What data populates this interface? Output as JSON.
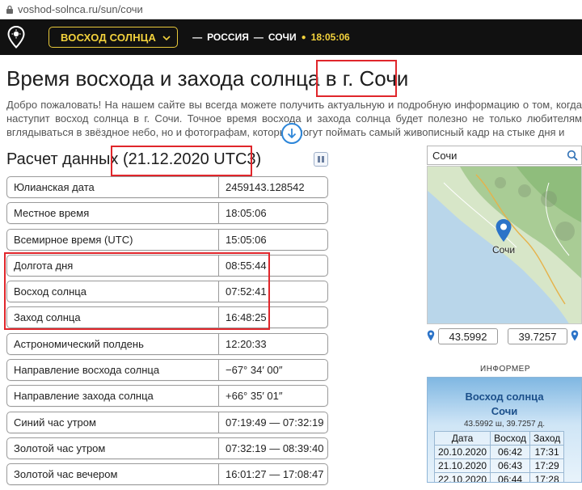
{
  "browser": {
    "url": "voshod-solnca.ru/sun/сочи"
  },
  "header": {
    "menu_label": "ВОСХОД СОЛНЦА",
    "crumb_country": "РОССИЯ",
    "crumb_city": "СОЧИ",
    "time": "18:05:06",
    "sep": "—",
    "dot": "●"
  },
  "page": {
    "title": "Время восхода и захода солнца в г. Сочи",
    "intro": "Добро пожаловать! На нашем сайте вы всегда можете получить актуальную и подробную информацию о том, когда наступит восход солнца в г. Сочи. Точное время восхода и захода солнца будет полезно не только любителям вглядываться в звёздное небо, но и фотографам, которые могут поймать самый живописный кадр на стыке дня и",
    "calc_title": "Расчет данных (21.12.2020 UTC3)"
  },
  "rows": [
    {
      "k": "Юлианская дата",
      "v": "2459143.128542"
    },
    {
      "k": "Местное время",
      "v": "18:05:06"
    },
    {
      "k": "Всемирное время (UTC)",
      "v": "15:05:06"
    },
    {
      "k": "Долгота дня",
      "v": "08:55:44"
    },
    {
      "k": "Восход солнца",
      "v": "07:52:41"
    },
    {
      "k": "Заход солнца",
      "v": "16:48:25"
    },
    {
      "k": "Астрономический полдень",
      "v": "12:20:33"
    },
    {
      "k": "Направление восхода солнца",
      "v": "−67° 34′ 00″"
    },
    {
      "k": "Направление захода солнца",
      "v": "+66° 35′ 01″"
    },
    {
      "k": "Синий час утром",
      "v": "07:19:49 — 07:32:19"
    },
    {
      "k": "Золотой час утром",
      "v": "07:32:19 — 08:39:40"
    },
    {
      "k": "Золотой час вечером",
      "v": "16:01:27 — 17:08:47"
    }
  ],
  "sidebar": {
    "search_value": "Сочи",
    "map_label": "Сочи",
    "lat": "43.5992",
    "lon": "39.7257",
    "informer_label": "ИНФОРМЕР",
    "informer": {
      "title": "Восход солнца",
      "city": "Сочи",
      "coords": "43.5992 ш, 39.7257 д.",
      "headers": [
        "Дата",
        "Восход",
        "Заход"
      ],
      "rows": [
        [
          "20.10.2020",
          "06:42",
          "17:31"
        ],
        [
          "21.10.2020",
          "06:43",
          "17:29"
        ],
        [
          "22.10.2020",
          "06:44",
          "17:28"
        ]
      ]
    }
  },
  "colors": {
    "accent": "#f3d23c",
    "highlight": "#e0262b",
    "header_bg": "#111111",
    "link": "#2d86d9"
  }
}
